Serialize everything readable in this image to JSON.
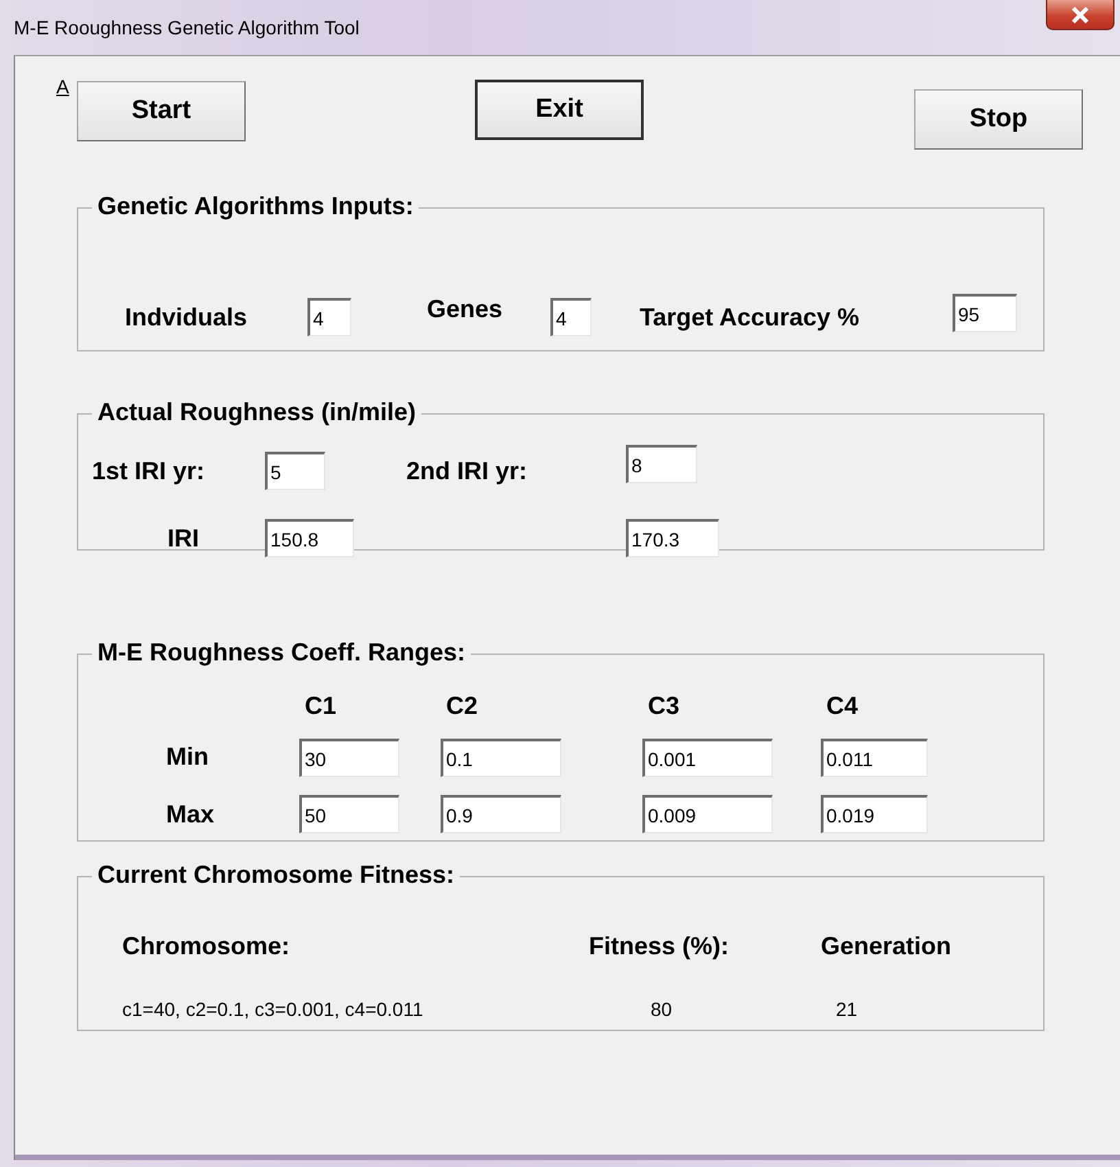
{
  "window": {
    "title": "M-E Rooughness Genetic Algorithm Tool"
  },
  "access_key_label": "A",
  "buttons": [
    {
      "label": "Start",
      "default": false
    },
    {
      "label": "Exit",
      "default": true
    },
    {
      "label": "Stop",
      "default": false
    }
  ],
  "ga_inputs": {
    "title": "Genetic Algorithms Inputs:",
    "fields": [
      {
        "label": "Indviduals",
        "value": "4"
      },
      {
        "label": "Genes",
        "value": "4"
      },
      {
        "label": "Target Accuracy %",
        "value": "95"
      }
    ]
  },
  "actual_roughness": {
    "title": "Actual Roughness (in/mile)",
    "year_labels": [
      "1st IRI yr:",
      "2nd IRI yr:"
    ],
    "years": [
      "5",
      "8"
    ],
    "iri_label": "IRI",
    "iri_values": [
      "150.8",
      "170.3"
    ]
  },
  "coeff_ranges": {
    "title": "M-E Roughness Coeff. Ranges:",
    "columns": [
      "C1",
      "C2",
      "C3",
      "C4"
    ],
    "rows": [
      {
        "label": "Min",
        "values": [
          "30",
          "0.1",
          "0.001",
          "0.011"
        ]
      },
      {
        "label": "Max",
        "values": [
          "50",
          "0.9",
          "0.009",
          "0.019"
        ]
      }
    ]
  },
  "fitness": {
    "title": "Current Chromosome Fitness:",
    "columns": [
      "Chromosome:",
      "Fitness (%):",
      "Generation"
    ],
    "values": [
      "c1=40, c2=0.1, c3=0.001, c4=0.011",
      "80",
      "21"
    ]
  }
}
